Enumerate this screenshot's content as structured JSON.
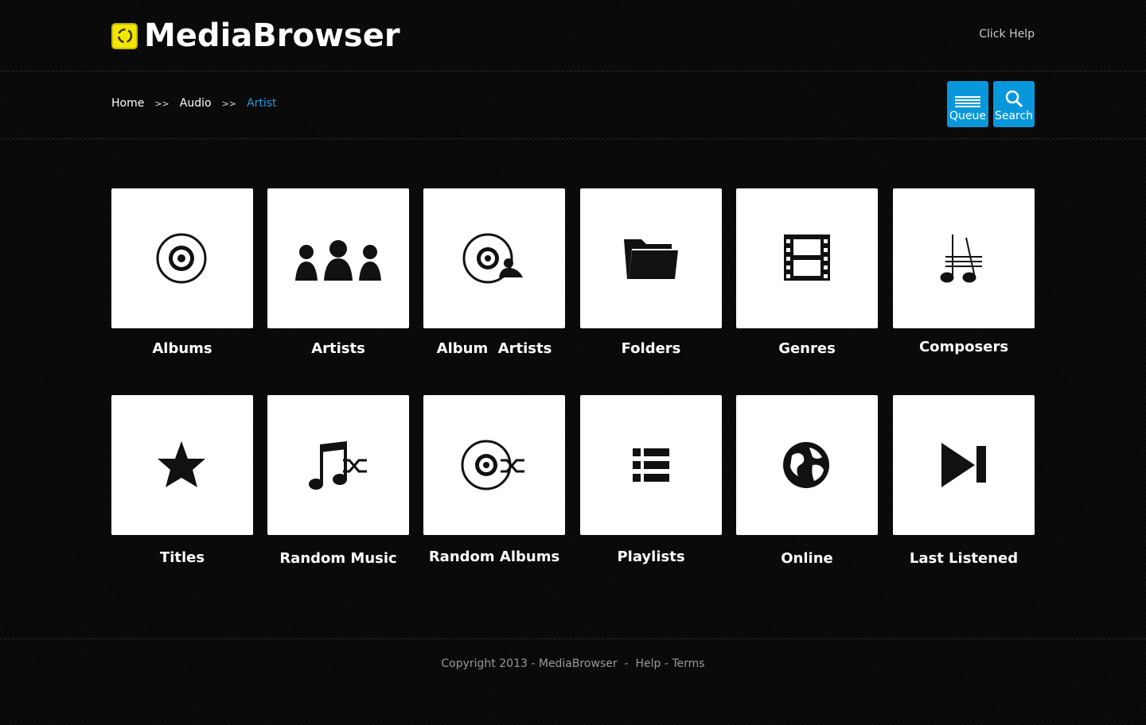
{
  "header": {
    "title": "MediaBrowser",
    "help_link": "Click Help"
  },
  "breadcrumb": {
    "items": [
      "Home",
      "Audio",
      "Artist"
    ],
    "separator": ">>"
  },
  "toolbar": {
    "queue_label": "Queue",
    "search_label": "Search",
    "accent": "#0997dc"
  },
  "tiles": [
    {
      "label": "Albums",
      "icon": "disc-icon"
    },
    {
      "label": "Artists",
      "icon": "users-icon"
    },
    {
      "label": "Album  Artists",
      "icon": "disc-user-icon"
    },
    {
      "label": "Folders",
      "icon": "folder-icon"
    },
    {
      "label": "Genres",
      "icon": "film-icon"
    },
    {
      "label": "Composers",
      "icon": "music-score-icon"
    },
    {
      "label": "Titles",
      "icon": "star-icon"
    },
    {
      "label": "Random Music",
      "icon": "music-shuffle-icon"
    },
    {
      "label": "Random Albums",
      "icon": "disc-shuffle-icon"
    },
    {
      "label": "Playlists",
      "icon": "list-icon"
    },
    {
      "label": "Online",
      "icon": "globe-icon"
    },
    {
      "label": "Last Listened",
      "icon": "skip-forward-icon"
    }
  ],
  "footer": {
    "copyright": "Copyright 2013 - MediaBrowser",
    "sep": "-",
    "help": "Help",
    "terms": "- Terms"
  }
}
